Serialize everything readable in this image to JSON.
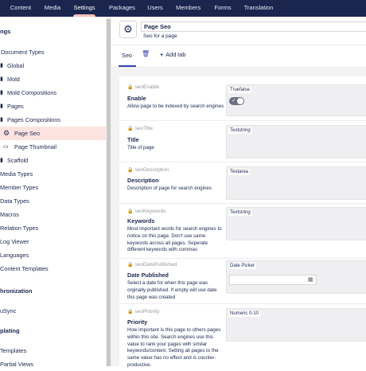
{
  "topnav": {
    "items": [
      "Content",
      "Media",
      "Settings",
      "Packages",
      "Users",
      "Members",
      "Forms",
      "Translation"
    ],
    "active": "Settings"
  },
  "sidebar": {
    "section_title": "ngs",
    "items": [
      {
        "label": "Document Types",
        "icon": "folder-icon"
      },
      {
        "label": "Global",
        "icon": "folder-icon"
      },
      {
        "label": "Mold",
        "icon": "folder-icon"
      },
      {
        "label": "Mold Compositions",
        "icon": "folder-icon"
      },
      {
        "label": "Pages",
        "icon": "folder-icon"
      },
      {
        "label": "Pages Compositions",
        "icon": "folder-icon"
      },
      {
        "label": "Page Seo",
        "icon": "gear-icon"
      },
      {
        "label": "Page Thumbnail",
        "icon": "image-icon"
      },
      {
        "label": "Scaffold",
        "icon": "folder-icon"
      },
      {
        "label": "Media Types"
      },
      {
        "label": "Member Types"
      },
      {
        "label": "Data Types"
      },
      {
        "label": "Macros"
      },
      {
        "label": "Relation Types"
      },
      {
        "label": "Log Viewer"
      },
      {
        "label": "Languages"
      },
      {
        "label": "Content Templates"
      }
    ],
    "section_2": "hronization",
    "sync_item": "uSync",
    "section_3": "plating",
    "templates_item": "Templates",
    "partial_item": "Partial Views"
  },
  "header": {
    "name": "Page Seo",
    "description": "Seo for a page",
    "icon": "gear-icon"
  },
  "tabs": {
    "active": "Seo",
    "add_label": "Add tab"
  },
  "properties": [
    {
      "alias": "seoEnable",
      "name": "Enable",
      "description": "Allow page to be indexed by search engines",
      "editor": "Truefalse",
      "value": true
    },
    {
      "alias": "seoTitle",
      "name": "Title",
      "description": "Title of page",
      "editor": "Textstring"
    },
    {
      "alias": "seoDescription",
      "name": "Description",
      "description": "Description of page for search engines",
      "editor": "Textarea"
    },
    {
      "alias": "seoKeywords",
      "name": "Keywords",
      "description": "Most important words for search engines to notice on this page. Don't use same keywords across all pages. Seperate different keywords with commas",
      "editor": "Textstring"
    },
    {
      "alias": "seoDatePublished",
      "name": "Date Published",
      "description": "Select a date for when this page was orginally published. If empty will use date this page was created",
      "editor": "Date Picker"
    },
    {
      "alias": "seoPriority",
      "name": "Priority",
      "description": "How important is this page to others pages within this site. Search engines use this value to rank your pages with similar keywords/content. Setting all pages to the same value has no effect and is counter-productive.",
      "editor": "Numeric 0-10"
    }
  ],
  "colors": {
    "nav_bg": "#1b264f",
    "accent": "#f5c1bc",
    "selected_row": "#fde3e0",
    "link_blue": "#3544b1"
  }
}
